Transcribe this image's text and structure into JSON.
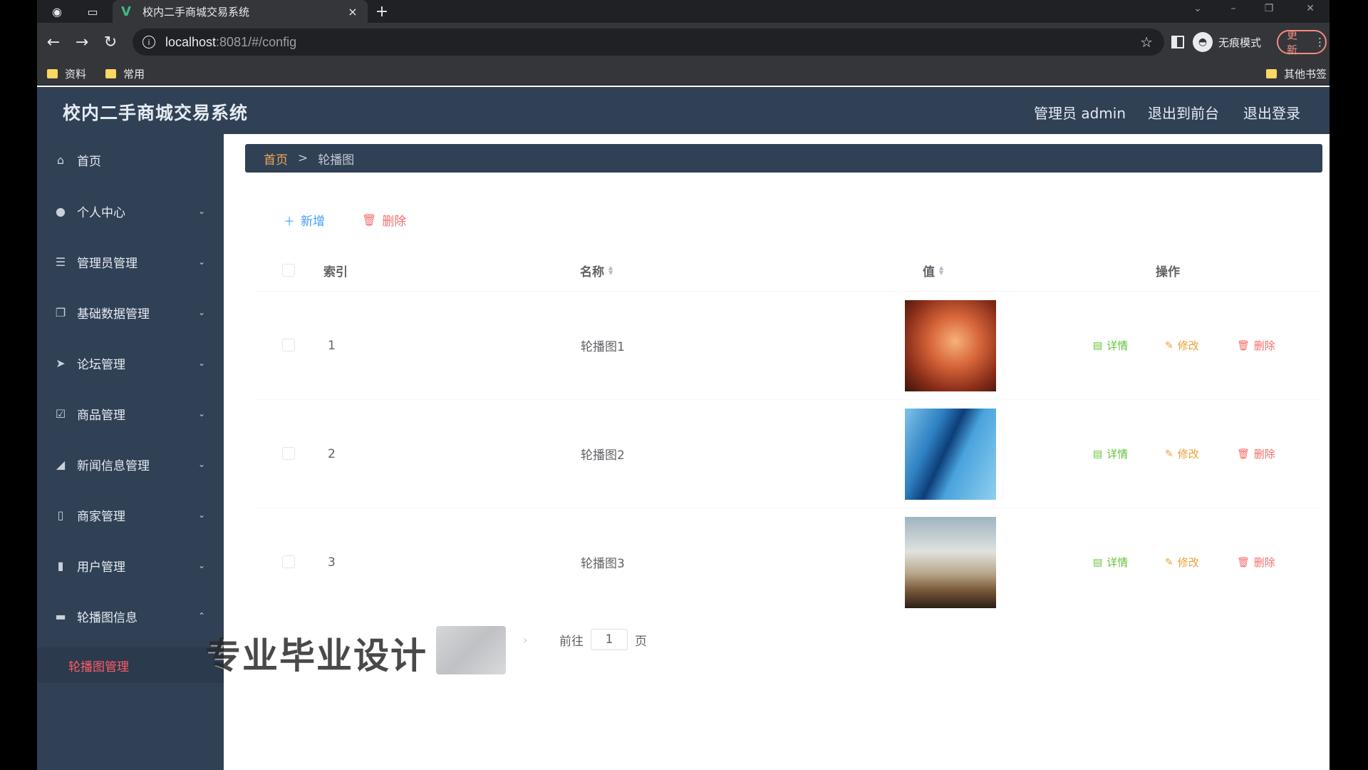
{
  "browser": {
    "tab_title": "校内二手商城交易系统",
    "tab_close": "×",
    "newtab": "+",
    "url_host": "localhost",
    "url_rest": ":8081/#/config",
    "incognito_label": "无痕模式",
    "update_label": "更新",
    "bookmarks": [
      "资料",
      "常用"
    ],
    "other_bookmarks": "其他书签"
  },
  "header": {
    "title": "校内二手商城交易系统",
    "admin": "管理员 admin",
    "to_front": "退出到前台",
    "logout": "退出登录"
  },
  "sidebar": {
    "items": [
      {
        "label": "首页",
        "icon": "home-icon"
      },
      {
        "label": "个人中心",
        "icon": "user-icon"
      },
      {
        "label": "管理员管理",
        "icon": "list-icon"
      },
      {
        "label": "基础数据管理",
        "icon": "copy-icon"
      },
      {
        "label": "论坛管理",
        "icon": "send-icon"
      },
      {
        "label": "商品管理",
        "icon": "checkbox-icon"
      },
      {
        "label": "新闻信息管理",
        "icon": "megaphone-icon"
      },
      {
        "label": "商家管理",
        "icon": "phone-icon"
      },
      {
        "label": "用户管理",
        "icon": "bar-icon"
      },
      {
        "label": "轮播图信息",
        "icon": "message-icon"
      }
    ],
    "active_sub": "轮播图管理"
  },
  "breadcrumb": {
    "home": "首页",
    "sep": ">",
    "current": "轮播图"
  },
  "actions": {
    "add": "新增",
    "delete": "删除"
  },
  "table": {
    "headers": {
      "index": "索引",
      "name": "名称",
      "value": "值",
      "ops": "操作"
    },
    "rows": [
      {
        "index": "1",
        "name": "轮播图1",
        "thumb": "fire"
      },
      {
        "index": "2",
        "name": "轮播图2",
        "thumb": "blue"
      },
      {
        "index": "3",
        "name": "轮播图3",
        "thumb": "road"
      }
    ],
    "op_labels": {
      "detail": "详情",
      "edit": "修改",
      "remove": "删除"
    }
  },
  "pager": {
    "goto": "前往",
    "page": "1",
    "unit": "页"
  },
  "watermark": "专业毕业设计"
}
